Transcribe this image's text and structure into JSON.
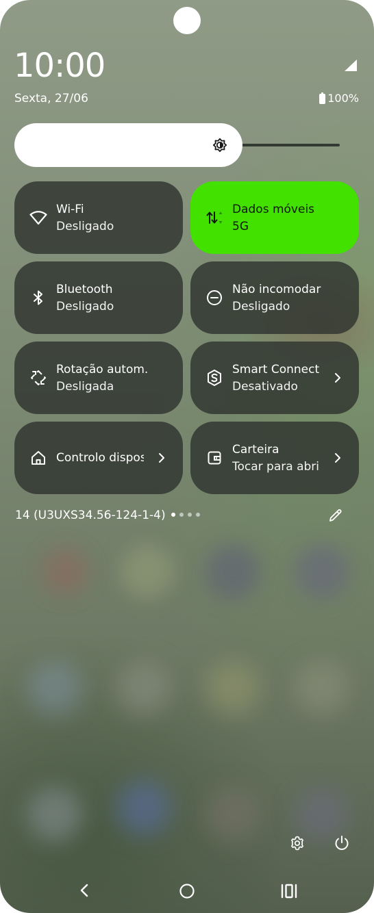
{
  "status": {
    "time": "10:00",
    "date": "Sexta, 27/06",
    "battery": "100%"
  },
  "brightness": {
    "level": 0.63
  },
  "tiles": [
    {
      "label": "Wi-Fi",
      "sub": "Desligado",
      "icon": "wifi-icon",
      "active": false
    },
    {
      "label": "Dados móveis",
      "sub": "5G",
      "icon": "mobile-data-icon",
      "active": true
    },
    {
      "label": "Bluetooth",
      "sub": "Desligado",
      "icon": "bluetooth-icon",
      "active": false
    },
    {
      "label": "Não incomodar",
      "sub": "Desligado",
      "icon": "do-not-disturb-icon",
      "active": false
    },
    {
      "label": "Rotação autom.",
      "sub": "Desligada",
      "icon": "auto-rotate-icon",
      "active": false
    },
    {
      "label": "Smart Connect",
      "sub": "Desativado",
      "icon": "smart-connect-icon",
      "active": false
    },
    {
      "label": "Controlo dispositivos",
      "sub": "",
      "icon": "home-icon",
      "active": false
    },
    {
      "label": "Carteira",
      "sub": "Tocar para abrir",
      "icon": "wallet-icon",
      "active": false
    }
  ],
  "footer": {
    "build": "14 (U3UXS34.56-124-1-4)",
    "page_count": 4,
    "current_page": 1
  },
  "colors": {
    "active_tile": "#43e100",
    "tile": "#30342f"
  }
}
